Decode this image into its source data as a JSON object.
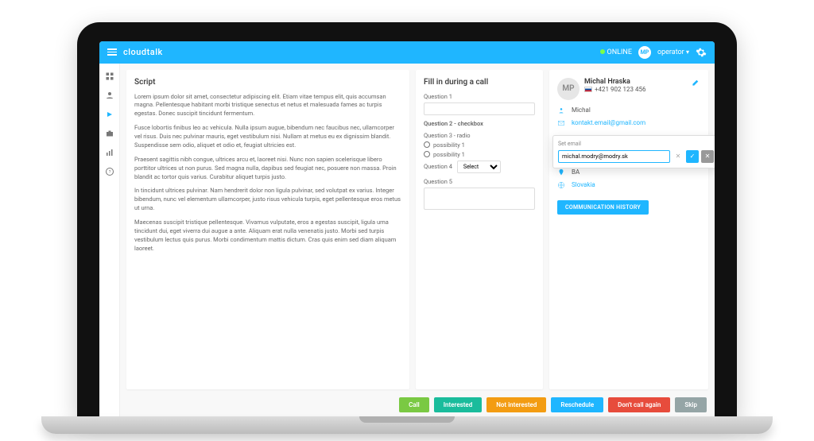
{
  "topbar": {
    "brand": "cloudtalk",
    "status": "ONLINE",
    "user_initials": "MP",
    "user_label": "operator"
  },
  "script": {
    "title": "Script",
    "paragraphs": [
      "Lorem ipsum dolor sit amet, consectetur adipiscing elit. Etiam vitae tempus elit, quis accumsan magna. Pellentesque habitant morbi tristique senectus et netus et malesuada fames ac turpis egestas. Donec suscipit tincidunt fermentum.",
      "Fusce lobortis finibus leo ac vehicula. Nulla ipsum augue, bibendum nec faucibus nec, ullamcorper vel risus. Duis nec pulvinar mauris, eget vestibulum nisi. Nullam at metus eu ex dignissim blandit. Suspendisse sem odio, aliquet et odio et, feugiat ultricies est.",
      "Praesent sagittis nibh congue, ultrices arcu et, laoreet nisi. Nunc non sapien scelerisque libero porttitor ultrices ut non purus. Sed magna nulla, dapibus sed feugiat nec, posuere non massa. Proin blandit ac tortor quis varius. Curabitur aliquet turpis justo.",
      "In tincidunt ultrices pulvinar. Nam hendrerit dolor non ligula pulvinar, sed volutpat ex varius. Integer bibendum, nunc vel elementum ullamcorper, justo risus vehicula turpis, eget pellentesque eros metus ut urna.",
      "Maecenas suscipit tristique pellentesque. Vivamus vulputate, eros a egestas suscipit, ligula urna tincidunt dui, eget viverra dui augue a ante. Aliquam erat nulla venenatis justo. Morbi sed turpis vestibulum lectus quis purus. Morbi condimentum mattis dictum. Cras quis enim sed diam aliquam laoreet."
    ]
  },
  "form": {
    "title": "Fill in during a call",
    "q1": "Question 1",
    "q2": "Question 2 - checkbox",
    "q3": "Question 3 - radio",
    "radio_a": "possibility 1",
    "radio_b": "possibility 1",
    "q4": "Question 4",
    "q4_select": "Select",
    "q5": "Question 5"
  },
  "contact": {
    "initials": "MP",
    "name": "Michal Hraska",
    "phone": "+421 902 123 456",
    "first_name": "Michal",
    "email": "kontakt.email@gmail.com",
    "region": "BA",
    "country": "Slovakia",
    "history_btn": "COMMUNICATION HISTORY"
  },
  "popover": {
    "title": "Set email",
    "value": "michal.modry@modry.sk"
  },
  "footer": {
    "call": "Call",
    "interested": "Interested",
    "not_interested": "Not interested",
    "reschedule": "Reschedule",
    "dont_call": "Don't call again",
    "skip": "Skip"
  }
}
